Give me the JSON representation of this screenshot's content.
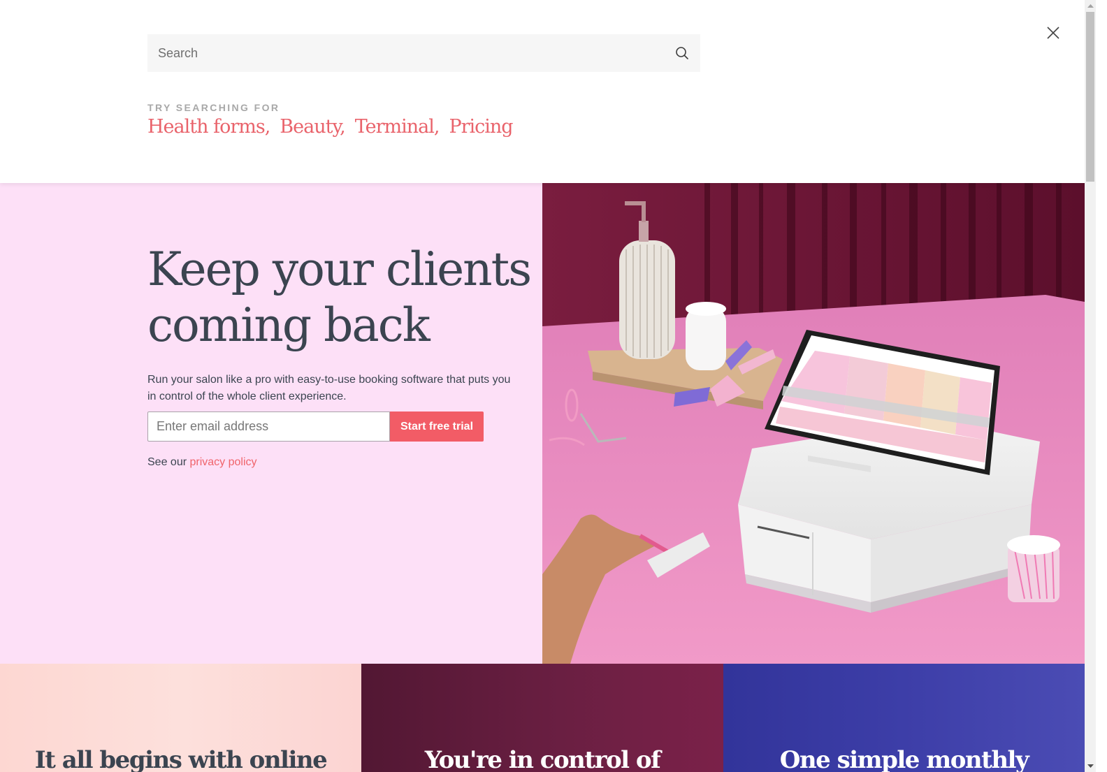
{
  "search": {
    "placeholder": "Search",
    "value": "",
    "icon": "search-icon",
    "close_icon": "close-icon",
    "try_label": "TRY SEARCHING FOR",
    "suggestions": [
      {
        "label": "Health forms,"
      },
      {
        "label": "Beauty,"
      },
      {
        "label": "Terminal,"
      },
      {
        "label": "Pricing"
      }
    ]
  },
  "hero": {
    "heading_line1": "Keep your clients",
    "heading_line2": "coming back",
    "description": "Run your salon like a pro with easy-to-use booking software that puts you in control of the whole client experience.",
    "email_placeholder": "Enter email address",
    "email_value": "",
    "cta_label": "Start free trial",
    "privacy_prefix": "See our ",
    "privacy_link": "privacy policy",
    "image_alt": "Salon desk with tablet booking calendar on a white POS cash drawer, pink table, soap dispenser, cotton pads, hair clips, eyelash curler and cotton buds"
  },
  "cards": [
    {
      "title": "It all begins with online"
    },
    {
      "title": "You're in control of"
    },
    {
      "title": "One simple monthly"
    }
  ],
  "colors": {
    "accent": "#f25c66",
    "link": "#e9636b",
    "hero_bg": "#fde0f7",
    "text": "#3b4450",
    "card1": "#fdd7d2",
    "card2": "#6a1f42",
    "card3": "#3d3ea8"
  }
}
